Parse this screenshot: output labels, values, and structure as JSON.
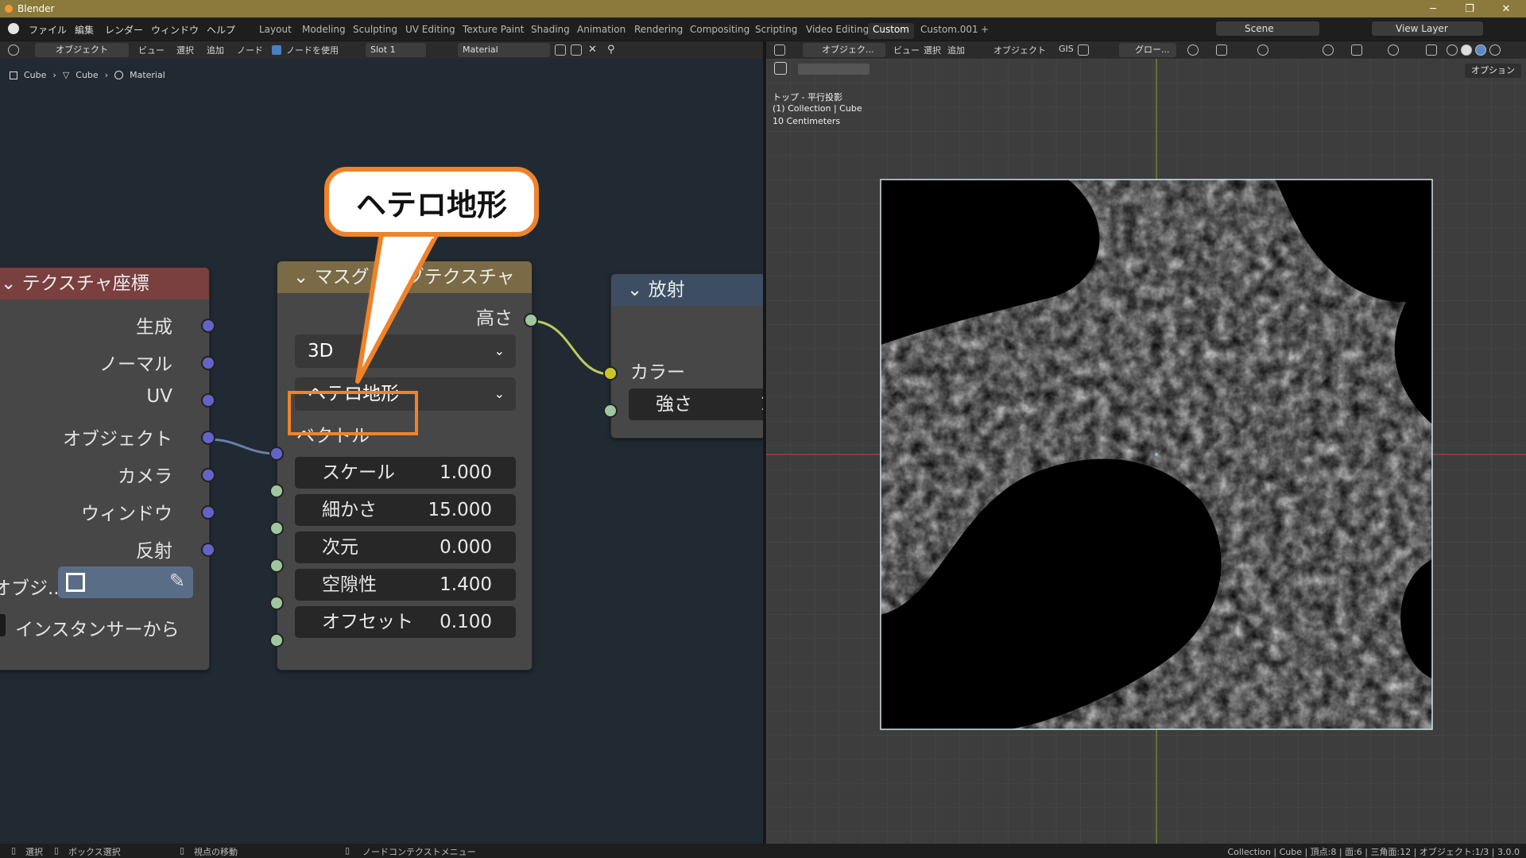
{
  "window": {
    "title": "Blender",
    "minimize": "─",
    "maximize": "❐",
    "close": "✕"
  },
  "menu": [
    "ファイル",
    "編集",
    "レンダー",
    "ウィンドウ",
    "ヘルプ"
  ],
  "workspaces": [
    "Layout",
    "Modeling",
    "Sculpting",
    "UV Editing",
    "Texture Paint",
    "Shading",
    "Animation",
    "Rendering",
    "Compositing",
    "Scripting",
    "Video Editing",
    "Custom",
    "Custom.001"
  ],
  "active_workspace": "Custom",
  "add_tab": "+",
  "scene": {
    "label": "Scene",
    "view_layer": "View Layer"
  },
  "node_header": {
    "mode": "オブジェクト",
    "view": "ビュー",
    "select": "選択",
    "add": "追加",
    "node": "ノード",
    "use_nodes": "ノードを使用",
    "slot": "Slot 1",
    "material": "Material"
  },
  "breadcrumb": [
    "Cube",
    "Cube",
    "Material"
  ],
  "nodes": {
    "texcoord": {
      "title": "テクスチャ座標",
      "outputs": [
        "生成",
        "ノーマル",
        "UV",
        "オブジェクト",
        "カメラ",
        "ウィンドウ",
        "反射"
      ],
      "object_label": "オブジ...",
      "from_instancer": "インスタンサーから"
    },
    "musgrave": {
      "title": "マスグレイブテクスチャ",
      "output": "高さ",
      "dimension": "3D",
      "type": "ヘテロ地形",
      "vector": "ベクトル",
      "fields": [
        {
          "label": "スケール",
          "value": "1.000"
        },
        {
          "label": "細かさ",
          "value": "15.000"
        },
        {
          "label": "次元",
          "value": "0.000"
        },
        {
          "label": "空隙性",
          "value": "1.400"
        },
        {
          "label": "オフセット",
          "value": "0.100"
        }
      ]
    },
    "emission": {
      "title": "放射",
      "color": "カラー",
      "strength": "強さ",
      "strength_value": "1"
    }
  },
  "callout": "ヘテロ地形",
  "viewport_header": {
    "mode": "オブジェク...",
    "view": "ビュー",
    "select": "選択",
    "add": "追加",
    "object": "オブジェクト",
    "gis": "GIS",
    "transform": "グロー...",
    "options": "オプション"
  },
  "viewport_info": {
    "view": "トップ - 平行投影",
    "collection": "(1) Collection | Cube",
    "scale": "10 Centimeters"
  },
  "statusbar": {
    "select": "選択",
    "box_select": "ボックス選択",
    "move_view": "視点の移動",
    "context_menu": "ノードコンテクストメニュー",
    "stats": "Collection | Cube | 頂点:8 | 面:6 | 三角面:12 | オブジェクト:1/3 | 3.0.0"
  },
  "colors": {
    "accent": "#f0832a",
    "title_bar": "#8b7a3c",
    "node_bg": "#212a33"
  }
}
